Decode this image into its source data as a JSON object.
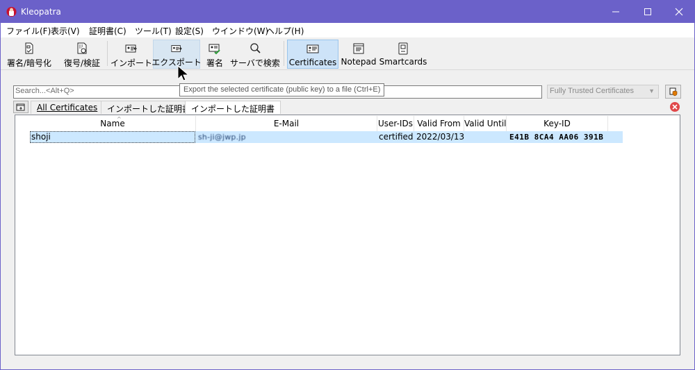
{
  "window": {
    "title": "Kleopatra",
    "title_color": "#6b61c9"
  },
  "menu": [
    {
      "label": "ファイル(F)"
    },
    {
      "label": "表示(V)"
    },
    {
      "label": "証明書(C)"
    },
    {
      "label": "ツール(T)"
    },
    {
      "label": "設定(S)"
    },
    {
      "label": "ウインドウ(W)"
    },
    {
      "label": "ヘルプ(H)"
    }
  ],
  "toolbar": {
    "sign_encrypt": "署名/暗号化",
    "decrypt_verify": "復号/検証",
    "import": "インポート",
    "export": "エクスポート",
    "sign": "署名",
    "lookup": "サーバで検索",
    "certificates": "Certificates",
    "notepad": "Notepad",
    "smartcards": "Smartcards"
  },
  "search": {
    "placeholder": "Search...<Alt+Q>"
  },
  "filter": {
    "selected": "Fully Trusted Certificates"
  },
  "tooltip": {
    "text": "Export the selected certificate (public key) to a file (Ctrl+E)"
  },
  "tabs": [
    {
      "label": "All Certificates"
    },
    {
      "label": "インポートした証明書"
    },
    {
      "label": "インポートした証明書"
    }
  ],
  "table": {
    "columns": [
      "Name",
      "E-Mail",
      "User-IDs",
      "Valid From",
      "Valid Until",
      "Key-ID"
    ],
    "rows": [
      {
        "name": "shoji",
        "email": "sh-ji@jwp.jp",
        "user_ids": "certified",
        "valid_from": "2022/03/13",
        "valid_until": "",
        "key_id": "E41B 8CA4 AA06 391B"
      }
    ]
  },
  "icons": {
    "app": "kleopatra-icon",
    "minimize": "minimize-icon",
    "maximize": "maximize-icon",
    "close": "close-icon"
  }
}
